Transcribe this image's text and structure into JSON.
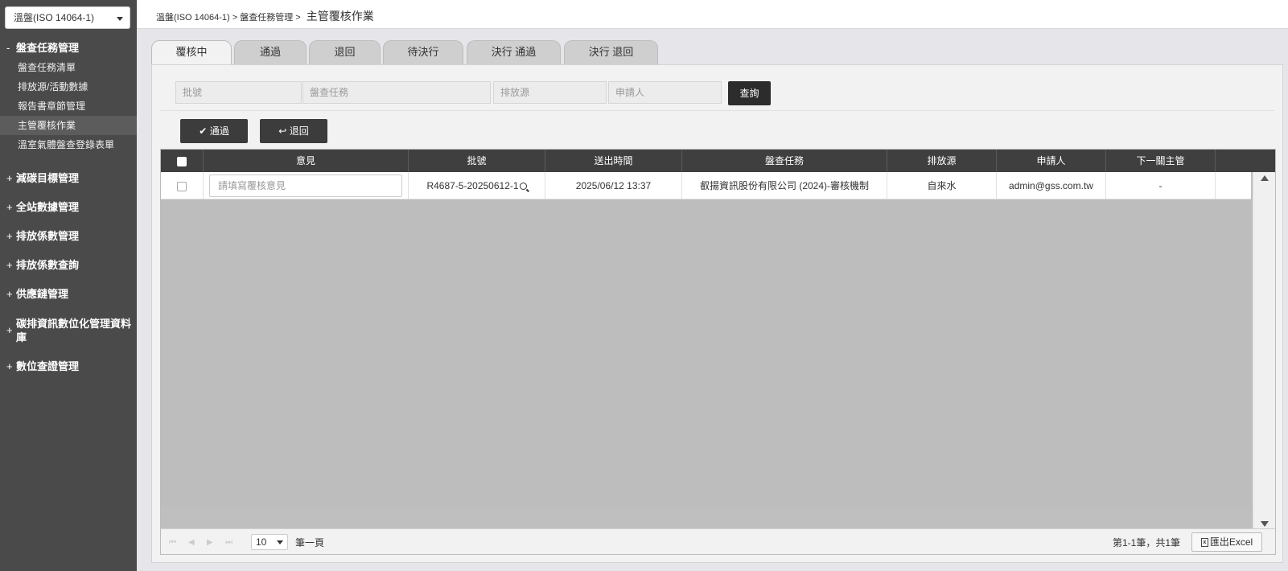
{
  "sidebar": {
    "system_select": "溫盤(ISO 14064-1)",
    "groups": [
      {
        "sign": "-",
        "label": "盤查任務管理",
        "items": [
          {
            "label": "盤查任務清單",
            "active": false
          },
          {
            "label": "排放源/活動數據",
            "active": false
          },
          {
            "label": "報告書章節管理",
            "active": false
          },
          {
            "label": "主管覆核作業",
            "active": true
          },
          {
            "label": "溫室氣體盤查登錄表單",
            "active": false
          }
        ]
      },
      {
        "sign": "+",
        "label": "減碳目標管理"
      },
      {
        "sign": "+",
        "label": "全站數據管理"
      },
      {
        "sign": "+",
        "label": "排放係數管理"
      },
      {
        "sign": "+",
        "label": "排放係數查詢"
      },
      {
        "sign": "+",
        "label": "供應鏈管理"
      },
      {
        "sign": "+",
        "label": "碳排資訊數位化管理資料庫"
      },
      {
        "sign": "+",
        "label": "數位查證管理"
      }
    ]
  },
  "breadcrumb": {
    "part1": "溫盤(ISO 14064-1) >",
    "part2": "盤查任務管理 >",
    "current": "主管覆核作業"
  },
  "tabs": [
    "覆核中",
    "通過",
    "退回",
    "待決行",
    "決行 通過",
    "決行 退回"
  ],
  "filters": {
    "batch_placeholder": "批號",
    "task_placeholder": "盤查任務",
    "source_placeholder": "排放源",
    "applicant_placeholder": "申請人",
    "query_label": "查詢"
  },
  "actions": {
    "approve_label": "通過",
    "reject_label": "退回"
  },
  "grid": {
    "columns": [
      "意見",
      "批號",
      "送出時間",
      "盤查任務",
      "排放源",
      "申請人",
      "下一關主管"
    ],
    "rows": [
      {
        "comment_placeholder": "請填寫覆核意見",
        "batch": "R4687-5-20250612-1",
        "sent_time": "2025/06/12 13:37",
        "task": "叡揚資訊股份有限公司 (2024)-審核機制",
        "source": "自來水",
        "applicant": "admin@gss.com.tw",
        "next_manager": "-"
      }
    ]
  },
  "pager": {
    "page_size": "10",
    "unit": "筆一頁",
    "info": "第1-1筆，共1筆",
    "export_label": "匯出Excel"
  }
}
